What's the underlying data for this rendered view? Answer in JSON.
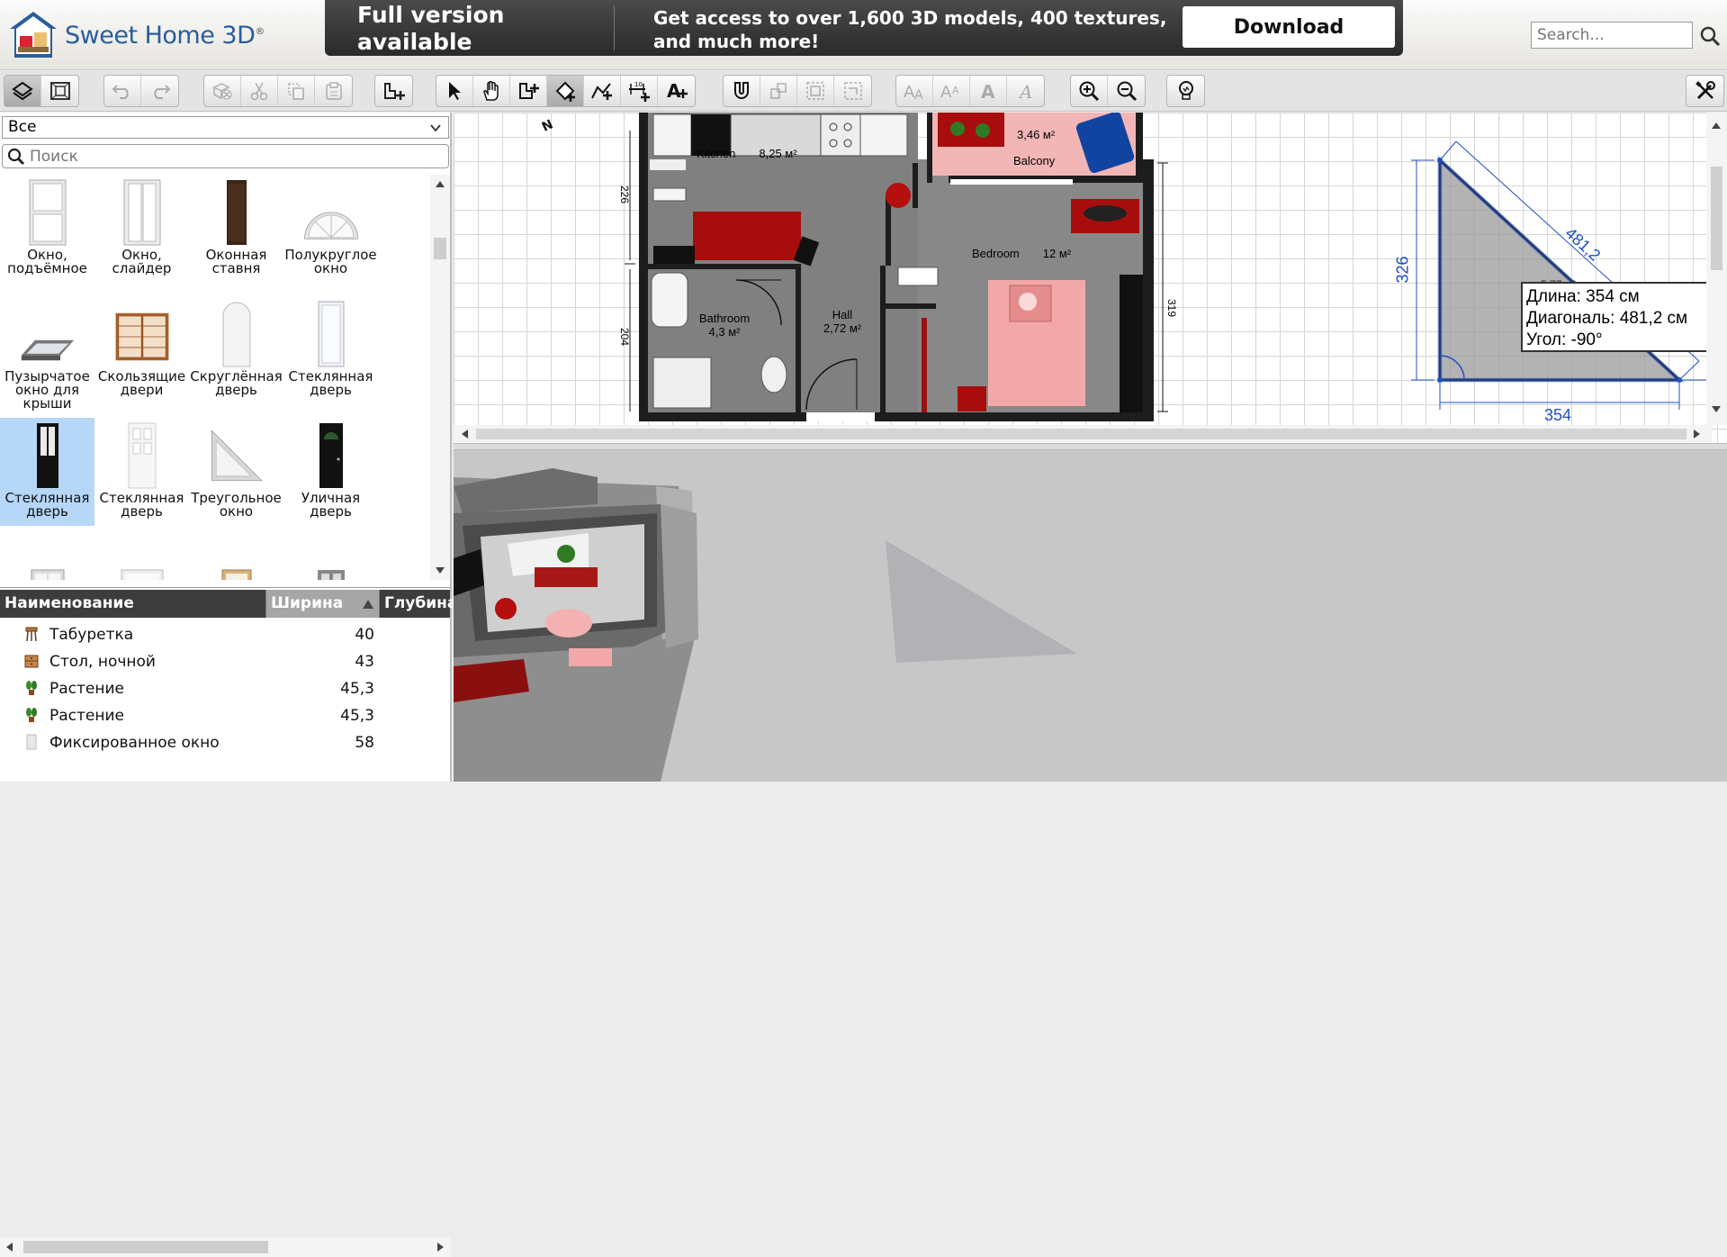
{
  "app": {
    "name": "Sweet Home 3D",
    "trademark": "®"
  },
  "promo": {
    "title": "Full version available",
    "text": "Get access to over 1,600 3D models, 400 textures, and much more!",
    "button": "Download"
  },
  "search": {
    "placeholder": "Search..."
  },
  "catalog": {
    "category": "Все",
    "search_placeholder": "Поиск",
    "items": [
      {
        "label": "Окно, подъёмное"
      },
      {
        "label": "Окно, слайдер"
      },
      {
        "label": "Оконная ставня"
      },
      {
        "label": "Полукруглое окно"
      },
      {
        "label": "Пузырчатое окно для крыши"
      },
      {
        "label": "Скользящие двери"
      },
      {
        "label": "Скруглённая дверь"
      },
      {
        "label": "Стеклянная дверь"
      },
      {
        "label": "Стеклянная дверь",
        "selected": true
      },
      {
        "label": "Стеклянная дверь"
      },
      {
        "label": "Треугольное окно"
      },
      {
        "label": "Уличная дверь"
      }
    ]
  },
  "furniture": {
    "columns": [
      "Наименование",
      "Ширина",
      "Глубина"
    ],
    "sorted_column": "Ширина",
    "rows": [
      {
        "name": "Табуретка",
        "width": "40",
        "icon": "stool-icon"
      },
      {
        "name": "Стол, ночной",
        "width": "43",
        "icon": "nightstand-icon"
      },
      {
        "name": "Растение",
        "width": "45,3",
        "icon": "plant-icon"
      },
      {
        "name": "Растение",
        "width": "45,3",
        "icon": "plant-icon"
      },
      {
        "name": "Фиксированное окно",
        "width": "58",
        "icon": "window-icon"
      }
    ]
  },
  "plan": {
    "rooms": [
      {
        "name": "Kitchen",
        "area": "8,25 м²"
      },
      {
        "name": "Balcony",
        "area": "3,46 м²"
      },
      {
        "name": "Bedroom",
        "area": "12 м²"
      },
      {
        "name": "Bathroom",
        "area": "4,3 м²"
      },
      {
        "name": "Hall",
        "area": "2,72 м²"
      }
    ],
    "dimensions": {
      "d226": "226",
      "d204": "204",
      "d319": "319"
    },
    "triangle": {
      "area": "5,77 м²",
      "height_label": "326",
      "base_label": "354",
      "diag_label": "481,2"
    },
    "tooltip": {
      "length": "Длина: 354 см",
      "diagonal": "Диагональ: 481,2 см",
      "angle": "Угол: -90°"
    }
  },
  "colors": {
    "accent": "#2a5d9c",
    "selection": "#b6d7f7",
    "dimension": "#1f4fc4",
    "header_dark": "#3d3d3d"
  }
}
